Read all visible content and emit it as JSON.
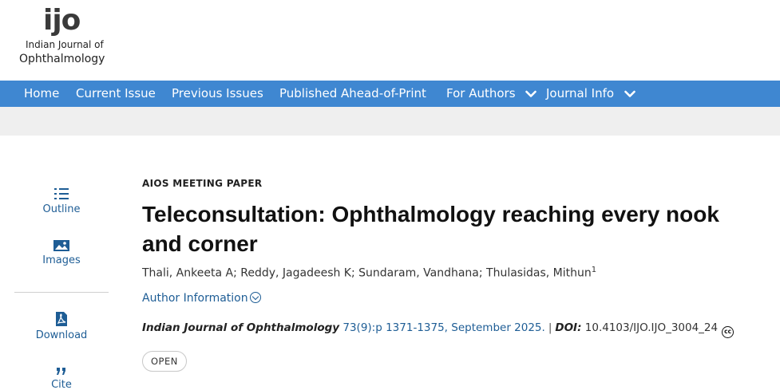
{
  "logo": {
    "mark": "ijo",
    "line1": "Indian Journal of",
    "line2": "Ophthalmology"
  },
  "nav": {
    "items": [
      {
        "label": "Home"
      },
      {
        "label": "Current Issue"
      },
      {
        "label": "Previous Issues"
      },
      {
        "label": "Published Ahead-of-Print"
      },
      {
        "label": "For Authors",
        "icon": "chevron-down-icon"
      },
      {
        "label": "Journal Info",
        "icon": "chevron-down-icon"
      }
    ]
  },
  "sidebar": {
    "items": [
      {
        "label": "Outline",
        "icon": "list-icon"
      },
      {
        "label": "Images",
        "icon": "image-icon"
      },
      {
        "label": "Download",
        "icon": "pdf-icon"
      },
      {
        "label": "Cite",
        "icon": "quote-icon"
      }
    ]
  },
  "article": {
    "kicker": "AIOS MEETING PAPER",
    "title": "Teleconsultation: Ophthalmology reaching every nook and corner",
    "authors": "Thali, Ankeeta A; Reddy, Jagadeesh K; Sundaram, Vandhana; Thulasidas, Mithun",
    "authors_sup": "1",
    "author_info": "Author Information",
    "journal": "Indian Journal of Ophthalmology",
    "citation_link": "73(9):p 1371-1375, September 2025.",
    "separator": "|",
    "doi_label": "DOI:",
    "doi": "10.4103/IJO.IJO_3004_24",
    "license_icon": "cc-icon",
    "license_text": "cc",
    "badge": "OPEN"
  },
  "colors": {
    "nav_bg": "#3f87d1",
    "link": "#1e5d95",
    "subbar_bg": "#efefef",
    "logo_dot": "#d9232e"
  }
}
